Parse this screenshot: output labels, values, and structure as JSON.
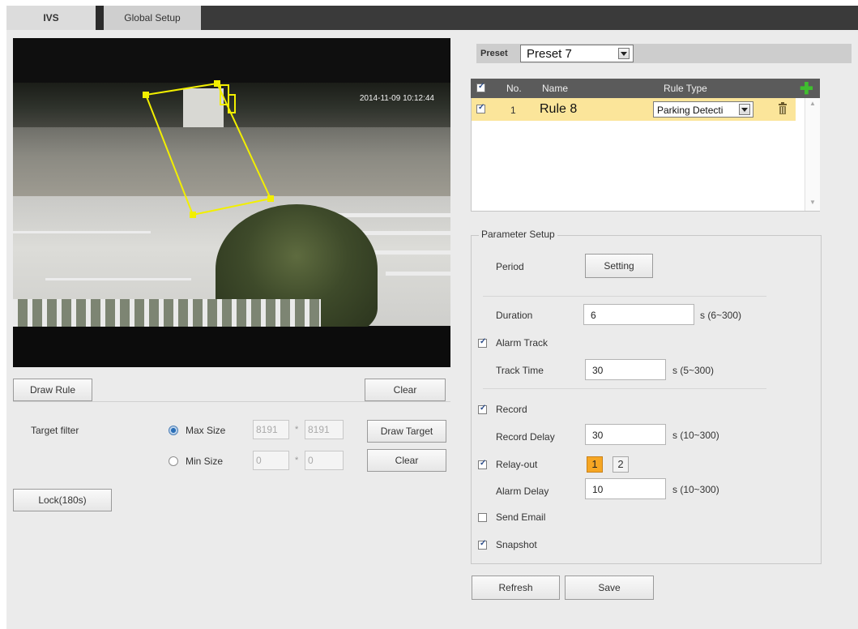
{
  "tabs": [
    {
      "label": "IVS",
      "active": true
    },
    {
      "label": "Global Setup",
      "active": false
    }
  ],
  "video": {
    "timestamp": "2014-11-09 10:12:44"
  },
  "left_controls": {
    "draw_rule": "Draw Rule",
    "clear_rule": "Clear",
    "target_filter_label": "Target filter",
    "max_size_label": "Max Size",
    "max_w": "8191",
    "max_h": "8191",
    "min_size_label": "Min Size",
    "min_w": "0",
    "min_h": "0",
    "times": "*",
    "draw_target": "Draw Target",
    "clear_target": "Clear",
    "lock": "Lock(180s)",
    "selected_size": "Max Size"
  },
  "preset": {
    "label": "Preset",
    "value": "Preset 7"
  },
  "rules": {
    "headers": {
      "no": "No.",
      "name": "Name",
      "type": "Rule Type"
    },
    "rows": [
      {
        "checked": true,
        "no": "1",
        "name": "Rule 8",
        "type": "Parking Detecti"
      }
    ]
  },
  "params": {
    "legend": "Parameter Setup",
    "period_label": "Period",
    "setting_btn": "Setting",
    "duration_label": "Duration",
    "duration_value": "6",
    "duration_range": "s (6~300)",
    "alarm_track_label": "Alarm Track",
    "alarm_track_checked": true,
    "track_time_label": "Track Time",
    "track_time_value": "30",
    "track_time_range": "s (5~300)",
    "record_label": "Record",
    "record_checked": true,
    "record_delay_label": "Record Delay",
    "record_delay_value": "30",
    "record_delay_range": "s (10~300)",
    "relay_out_label": "Relay-out",
    "relay_out_checked": true,
    "relay_1": "1",
    "relay_2": "2",
    "alarm_delay_label": "Alarm Delay",
    "alarm_delay_value": "10",
    "alarm_delay_range": "s (10~300)",
    "send_email_label": "Send Email",
    "send_email_checked": false,
    "snapshot_label": "Snapshot",
    "snapshot_checked": true
  },
  "footer": {
    "refresh": "Refresh",
    "save": "Save"
  },
  "colors": {
    "rule_line": "#f2ef00",
    "selected_row": "#fbe59a",
    "relay_active": "#f6a623",
    "add_icon": "#38a832"
  }
}
